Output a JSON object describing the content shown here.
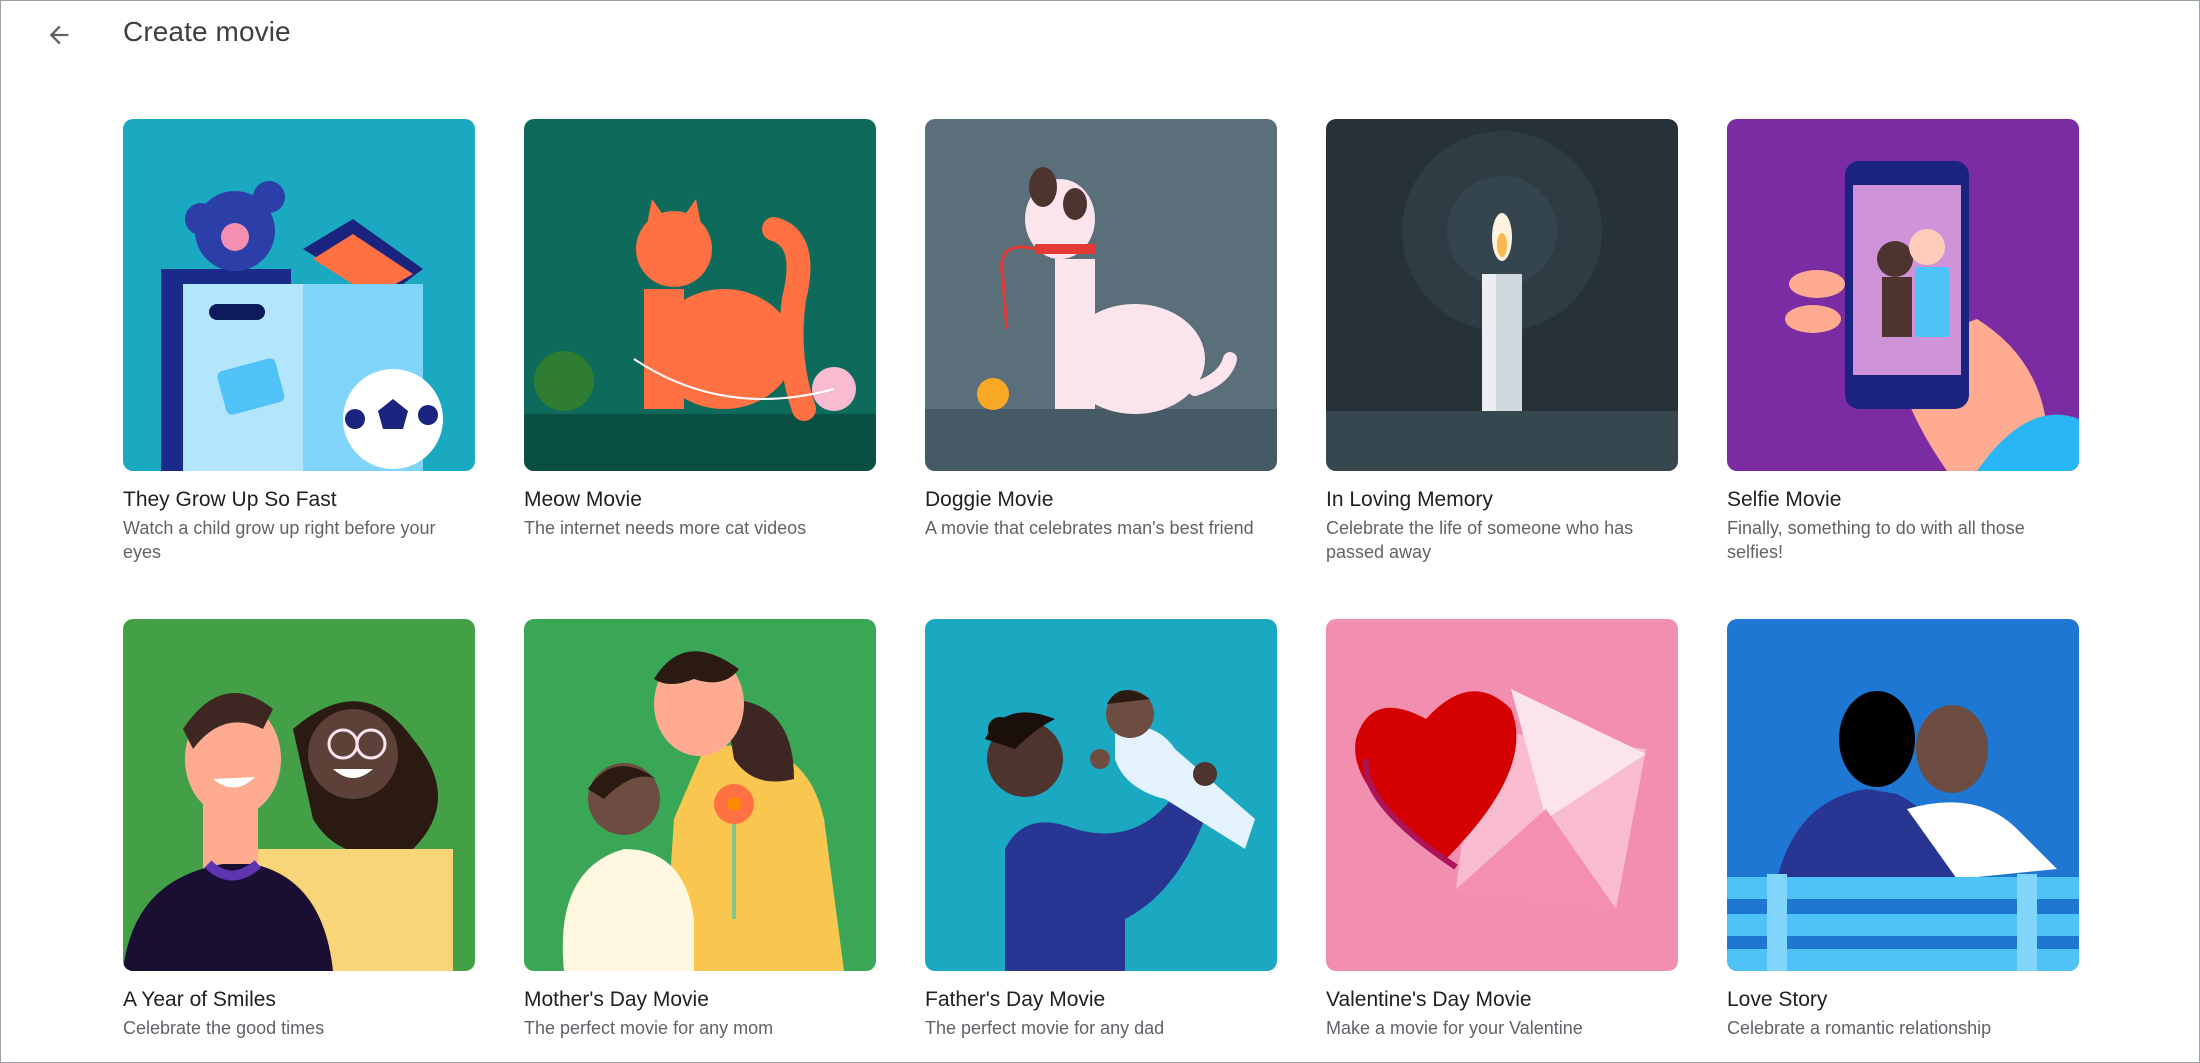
{
  "header": {
    "title": "Create movie",
    "back_icon": "arrow-back-icon"
  },
  "templates": [
    {
      "title": "They Grow Up So Fast",
      "description": "Watch a child grow up right before your eyes",
      "bg": "#1ba9c2",
      "art": "toy-box"
    },
    {
      "title": "Meow Movie",
      "description": "The internet needs more cat videos",
      "bg": "#0e6b5b",
      "art": "cat"
    },
    {
      "title": "Doggie Movie",
      "description": "A movie that celebrates man's best friend",
      "bg": "#5b6f7a",
      "art": "dog"
    },
    {
      "title": "In Loving Memory",
      "description": "Celebrate the life of someone who has passed away",
      "bg": "#263238",
      "art": "candle"
    },
    {
      "title": "Selfie Movie",
      "description": "Finally, something to do with all those selfies!",
      "bg": "#7b2ca3",
      "art": "phone-selfie"
    },
    {
      "title": "A Year of Smiles",
      "description": "Celebrate the good times",
      "bg": "#43a047",
      "art": "couple-smiling"
    },
    {
      "title": "Mother's Day Movie",
      "description": "The perfect movie for any mom",
      "bg": "#3aa757",
      "art": "mother-child"
    },
    {
      "title": "Father's Day Movie",
      "description": "The perfect movie for any dad",
      "bg": "#1ba9c2",
      "art": "father-baby"
    },
    {
      "title": "Valentine's Day Movie",
      "description": "Make a movie for your Valentine",
      "bg": "#f28fb1",
      "art": "heart-envelope"
    },
    {
      "title": "Love Story",
      "description": "Celebrate a romantic relationship",
      "bg": "#1e77d3",
      "art": "couple-bench"
    }
  ]
}
